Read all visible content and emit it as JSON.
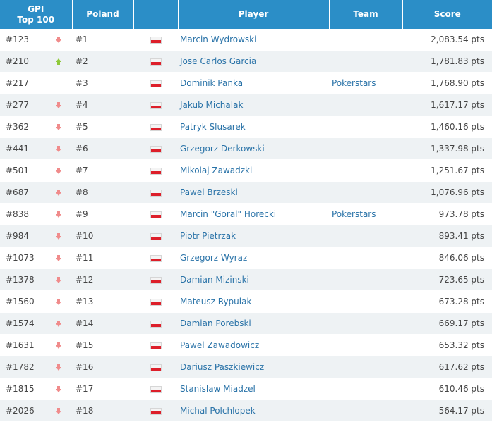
{
  "colors": {
    "header_bg": "#2b8ec7",
    "link": "#2a73a8",
    "trend_down": "#f08b8b",
    "trend_up": "#8fc93a",
    "stripe": "#eef2f4"
  },
  "header": {
    "gpi_line1": "GPI",
    "gpi_line2": "Top 100",
    "poland": "Poland",
    "player": "Player",
    "team": "Team",
    "score": "Score"
  },
  "rows": [
    {
      "gpi": "#123",
      "trend": "down",
      "poland": "#1",
      "flag": "poland-flag-icon",
      "player": "Marcin Wydrowski",
      "team": "",
      "score": "2,083.54 pts"
    },
    {
      "gpi": "#210",
      "trend": "up",
      "poland": "#2",
      "flag": "poland-flag-icon",
      "player": "Jose Carlos Garcia",
      "team": "",
      "score": "1,781.83 pts"
    },
    {
      "gpi": "#217",
      "trend": "none",
      "poland": "#3",
      "flag": "poland-flag-icon",
      "player": "Dominik Panka",
      "team": "Pokerstars",
      "score": "1,768.90 pts"
    },
    {
      "gpi": "#277",
      "trend": "down",
      "poland": "#4",
      "flag": "poland-flag-icon",
      "player": "Jakub Michalak",
      "team": "",
      "score": "1,617.17 pts"
    },
    {
      "gpi": "#362",
      "trend": "down",
      "poland": "#5",
      "flag": "poland-flag-icon",
      "player": "Patryk Slusarek",
      "team": "",
      "score": "1,460.16 pts"
    },
    {
      "gpi": "#441",
      "trend": "down",
      "poland": "#6",
      "flag": "poland-flag-icon",
      "player": "Grzegorz Derkowski",
      "team": "",
      "score": "1,337.98 pts"
    },
    {
      "gpi": "#501",
      "trend": "down",
      "poland": "#7",
      "flag": "poland-flag-icon",
      "player": "Mikolaj Zawadzki",
      "team": "",
      "score": "1,251.67 pts"
    },
    {
      "gpi": "#687",
      "trend": "down",
      "poland": "#8",
      "flag": "poland-flag-icon",
      "player": "Pawel Brzeski",
      "team": "",
      "score": "1,076.96 pts"
    },
    {
      "gpi": "#838",
      "trend": "down",
      "poland": "#9",
      "flag": "poland-flag-icon",
      "player": "Marcin \"Goral\" Horecki",
      "team": "Pokerstars",
      "score": "973.78 pts"
    },
    {
      "gpi": "#984",
      "trend": "down",
      "poland": "#10",
      "flag": "poland-flag-icon",
      "player": "Piotr Pietrzak",
      "team": "",
      "score": "893.41 pts"
    },
    {
      "gpi": "#1073",
      "trend": "down",
      "poland": "#11",
      "flag": "poland-flag-icon",
      "player": "Grzegorz Wyraz",
      "team": "",
      "score": "846.06 pts"
    },
    {
      "gpi": "#1378",
      "trend": "down",
      "poland": "#12",
      "flag": "poland-flag-icon",
      "player": "Damian Mizinski",
      "team": "",
      "score": "723.65 pts"
    },
    {
      "gpi": "#1560",
      "trend": "down",
      "poland": "#13",
      "flag": "poland-flag-icon",
      "player": "Mateusz Rypulak",
      "team": "",
      "score": "673.28 pts"
    },
    {
      "gpi": "#1574",
      "trend": "down",
      "poland": "#14",
      "flag": "poland-flag-icon",
      "player": "Damian Porebski",
      "team": "",
      "score": "669.17 pts"
    },
    {
      "gpi": "#1631",
      "trend": "down",
      "poland": "#15",
      "flag": "poland-flag-icon",
      "player": "Pawel Zawadowicz",
      "team": "",
      "score": "653.32 pts"
    },
    {
      "gpi": "#1782",
      "trend": "down",
      "poland": "#16",
      "flag": "poland-flag-icon",
      "player": "Dariusz Paszkiewicz",
      "team": "",
      "score": "617.62 pts"
    },
    {
      "gpi": "#1815",
      "trend": "down",
      "poland": "#17",
      "flag": "poland-flag-icon",
      "player": "Stanislaw Miadzel",
      "team": "",
      "score": "610.46 pts"
    },
    {
      "gpi": "#2026",
      "trend": "down",
      "poland": "#18",
      "flag": "poland-flag-icon",
      "player": "Michal Polchlopek",
      "team": "",
      "score": "564.17 pts"
    }
  ]
}
